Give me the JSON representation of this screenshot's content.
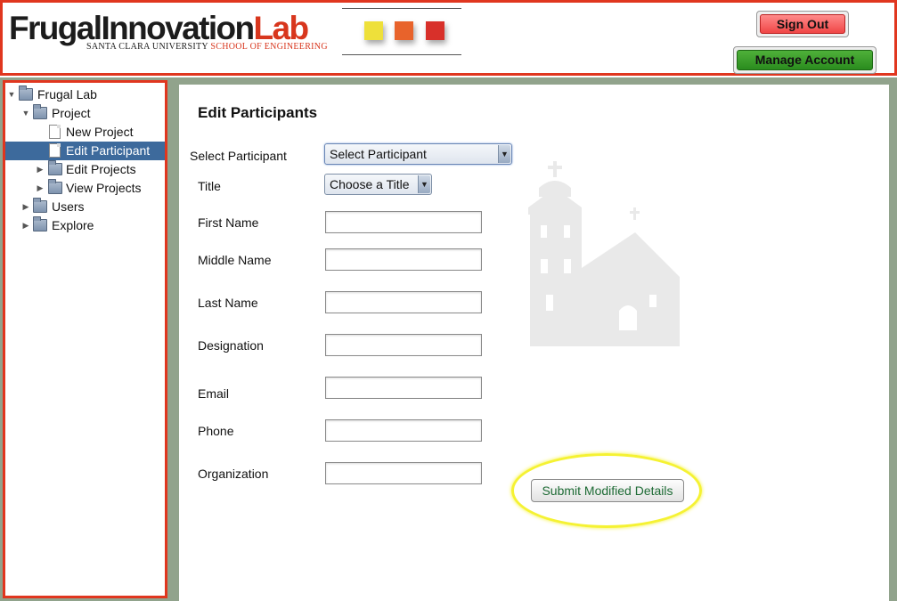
{
  "header": {
    "logo_main_part1": "FrugalInnovation",
    "logo_main_part2": "Lab",
    "logo_sub_part1": "SANTA CLARA UNIVERSITY",
    "logo_sub_part2": "SCHOOL OF ENGINEERING",
    "sign_out_label": "Sign Out",
    "manage_account_label": "Manage Account",
    "colors": {
      "accent_border": "#e0361f",
      "sign_out": "#f04646",
      "manage_account": "#2a8c1e"
    }
  },
  "sidebar": {
    "items": [
      {
        "label": "Frugal Lab",
        "icon": "folder-icon",
        "expanded": true,
        "selected": false
      },
      {
        "label": "Project",
        "icon": "folder-icon",
        "expanded": true,
        "selected": false
      },
      {
        "label": "New Project",
        "icon": "document-icon",
        "selected": false
      },
      {
        "label": "Edit Participant",
        "icon": "document-icon",
        "selected": true
      },
      {
        "label": "Edit Projects",
        "icon": "folder-icon",
        "expanded": false,
        "selected": false
      },
      {
        "label": "View Projects",
        "icon": "folder-icon",
        "expanded": false,
        "selected": false
      },
      {
        "label": "Users",
        "icon": "folder-icon",
        "expanded": false,
        "selected": false
      },
      {
        "label": "Explore",
        "icon": "folder-icon",
        "expanded": false,
        "selected": false
      }
    ],
    "colors": {
      "selected_bg": "#3d6a9c"
    }
  },
  "main": {
    "title": "Edit Participants",
    "select_participant_label": "Select Participant",
    "select_participant_value": "Select Participant",
    "title_label": "Title",
    "title_value": "Choose a Title",
    "fields": {
      "first_name": {
        "label": "First Name",
        "value": ""
      },
      "middle_name": {
        "label": "Middle Name",
        "value": ""
      },
      "last_name": {
        "label": "Last Name",
        "value": ""
      },
      "designation": {
        "label": "Designation",
        "value": ""
      },
      "email": {
        "label": "Email",
        "value": ""
      },
      "phone": {
        "label": "Phone",
        "value": ""
      },
      "organization": {
        "label": "Organization",
        "value": ""
      }
    },
    "submit_label": "Submit Modified Details",
    "colors": {
      "frame": "#91a38c",
      "highlight": "#f5f233",
      "submit_text": "#1e6b35"
    }
  }
}
